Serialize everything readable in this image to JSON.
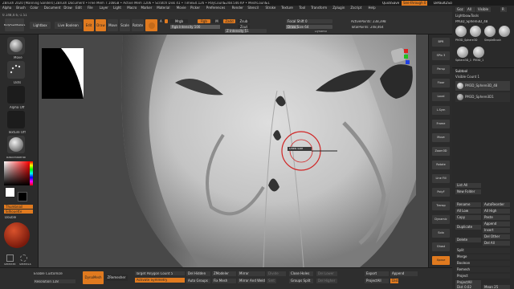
{
  "titlebar": {
    "title": "ZBrush 2020 [Manning Sanders]   ZBrush Document   • Free Mem 7.108GB • Active Mem 1206 • Scratch Disk 41 • Timer▸0.126 • PolyCount▸248.546 KP • MeshCount▸1",
    "quicksave": "QuickSave",
    "seethrough": "See-through  0",
    "script": "DefaultZScript"
  },
  "menu": [
    "Alpha",
    "Brush",
    "Color",
    "Document",
    "Draw",
    "Edit",
    "File",
    "Layer",
    "Light",
    "Macro",
    "Marker",
    "Material",
    "Movie",
    "Picker",
    "Preferences",
    "Render",
    "Stencil",
    "Stroke",
    "Texture",
    "Tool",
    "Transform",
    "Zplugin",
    "Zscript",
    "Help"
  ],
  "toolbar": {
    "coords": "0.148,0.6,-1.51",
    "left_buttons": [
      "BodyFeedMasters",
      "Lightbox",
      "Live Boolean"
    ],
    "mode_buttons": [
      "Edit",
      "Draw",
      "Move",
      "Scale",
      "Rotate"
    ],
    "mrgb": "Mrgb",
    "rgb": "Rgb",
    "m": "M",
    "zadd": "Zadd",
    "zsub": "Zsub",
    "zcut": "Zcut",
    "rgb_intensity": "Rgb Intensity 100",
    "z_intensity": "Z Intensity 51",
    "focal_shift": "Focal Shift 0",
    "draw_size": "Draw Size 64",
    "dynamic": "Dynamic",
    "active_points": "ActivePoints: 238,398",
    "total_points": "TotalPoints: 248,464"
  },
  "left_tray": {
    "brush_label": "Move",
    "stroke_label": "Dots",
    "alpha_label": "Alpha Off",
    "texture_label": "Texture Off",
    "material_label": "BasicMaterial",
    "gradient": "Gradient",
    "switch_color": "SwitchColor",
    "alternate": "Alternate",
    "thumbnail": "Thumbnail",
    "silhouette": "Silhouette",
    "double": "Double",
    "selectrect": "SelectRt",
    "selectlasso": "SelectLs"
  },
  "right_shelf": [
    "BPR",
    "SPix 3",
    "Persp",
    "Floor",
    "Local",
    "L.Sym",
    "Frame",
    "Move",
    "Zoom3D",
    "Rotate",
    "Line Fill",
    "PolyF",
    "Transp",
    "Dynamic",
    "Solo",
    "Ghost",
    "Xpose"
  ],
  "subtool": {
    "header_buttons": [
      "Goz",
      "All",
      "Visible",
      "R"
    ],
    "lightbox_tools": "Lightbox▸Tools",
    "tool_name": "PM3D_Sphere3D_48",
    "thumbs": [
      "PM3D_Sphere3D",
      "Sphere3D",
      "PolyMesh3D",
      "SimpleBrush",
      "Sphere3D_1",
      "PM3D_1"
    ],
    "title": "Subtool",
    "visible_count": "Visible Count 1",
    "items": [
      "PM3D_Sphere3D_48",
      "PM3D_Sphere3D1"
    ],
    "list_all": "List All",
    "new_folder": "New Folder",
    "rename": "Rename",
    "autoreorder": "AutoReorder",
    "all_low": "All Low",
    "all_high": "All High",
    "copy": "Copy",
    "paste": "Paste",
    "duplicate": "Duplicate",
    "append": "Append",
    "insert": "Insert",
    "delete": "Delete",
    "del_other": "Del Other",
    "del_all": "Del All",
    "split": "Split",
    "merge": "Merge",
    "boolean": "Boolean",
    "remesh": "Remesh",
    "project": "Project",
    "projectall": "ProjectAll",
    "dist": "Dist 0.02",
    "mean": "Mean 25"
  },
  "bottom": {
    "enable_customize": "Enable Customize",
    "dynamesh": "DynaMesh",
    "zremesher": "ZRemesher",
    "target_poly": "Target Polygon Count 5",
    "activate_symmetry": "Activate Symmetry",
    "del_hidden": "Del Hidden",
    "auto_groups": "Auto Groups",
    "zmodeler": "ZModeler",
    "fix_mesh": "Fix Mesh",
    "mirror": "Mirror",
    "mirror_weld": "Mirror And Weld",
    "close_holes": "Close Holes",
    "groups_split": "Groups Split",
    "del_lower": "Del Lower",
    "del_higher": "Del Higher",
    "export": "Export",
    "import": "Import",
    "projectall": "ProjectAll",
    "append": "Append",
    "resolution": "Resolution 128",
    "divide": "Divide",
    "smt": "Smt",
    "dist": "Dist"
  },
  "cursor_label": "Draw Size",
  "colors": {
    "accent": "#e07a1f",
    "panel": "#2b2b2b",
    "canvas": "#484848"
  }
}
